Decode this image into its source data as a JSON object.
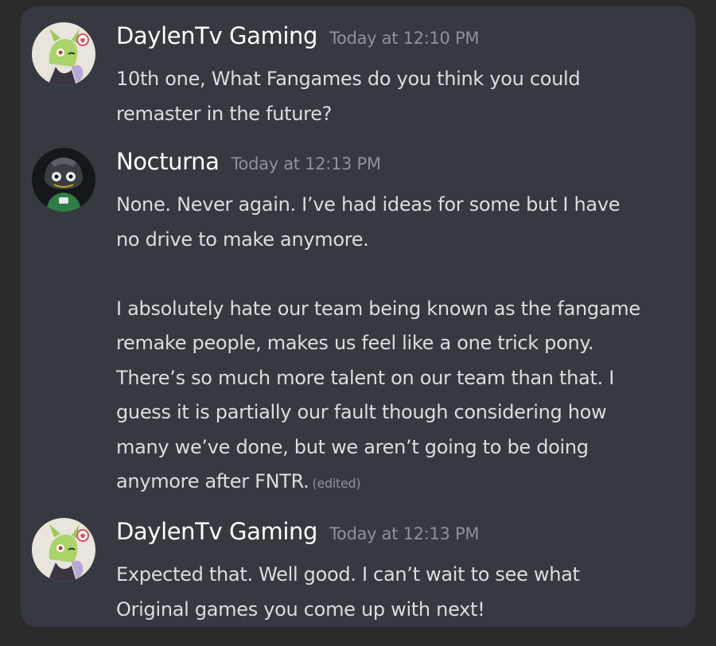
{
  "messages": [
    {
      "author": "DaylenTv Gaming",
      "timestamp": "Today at 12:10 PM",
      "avatar_icon": "green-character-avatar-icon",
      "lines": [
        "10th one, What Fangames do you think you could",
        "remaster in the future?"
      ]
    },
    {
      "author": "Nocturna",
      "timestamp": "Today at 12:13 PM",
      "avatar_icon": "dark-character-avatar-icon",
      "paragraph1": [
        "None. Never again. I’ve had ideas for some but I have",
        "no drive to make anymore."
      ],
      "paragraph2": [
        "I absolutely hate our team being known as the fangame",
        "remake people, makes us feel like a one trick pony.",
        "There’s so much more talent on our team than that. I",
        "guess it is partially our fault though considering how",
        "many we’ve done, but we aren’t going to be doing",
        "anymore after FNTR."
      ],
      "edited_label": "(edited)"
    },
    {
      "author": "DaylenTv Gaming",
      "timestamp": "Today at 12:13 PM",
      "avatar_icon": "green-character-avatar-icon",
      "lines": [
        "Expected that. Well good. I can’t wait to see what",
        "Original games you come up with next!"
      ]
    }
  ],
  "colors": {
    "background": "#2b2b2b",
    "panel": "#36393f",
    "username": "#ffffff",
    "message_text": "#dcddde",
    "timestamp": "#8e9297"
  }
}
